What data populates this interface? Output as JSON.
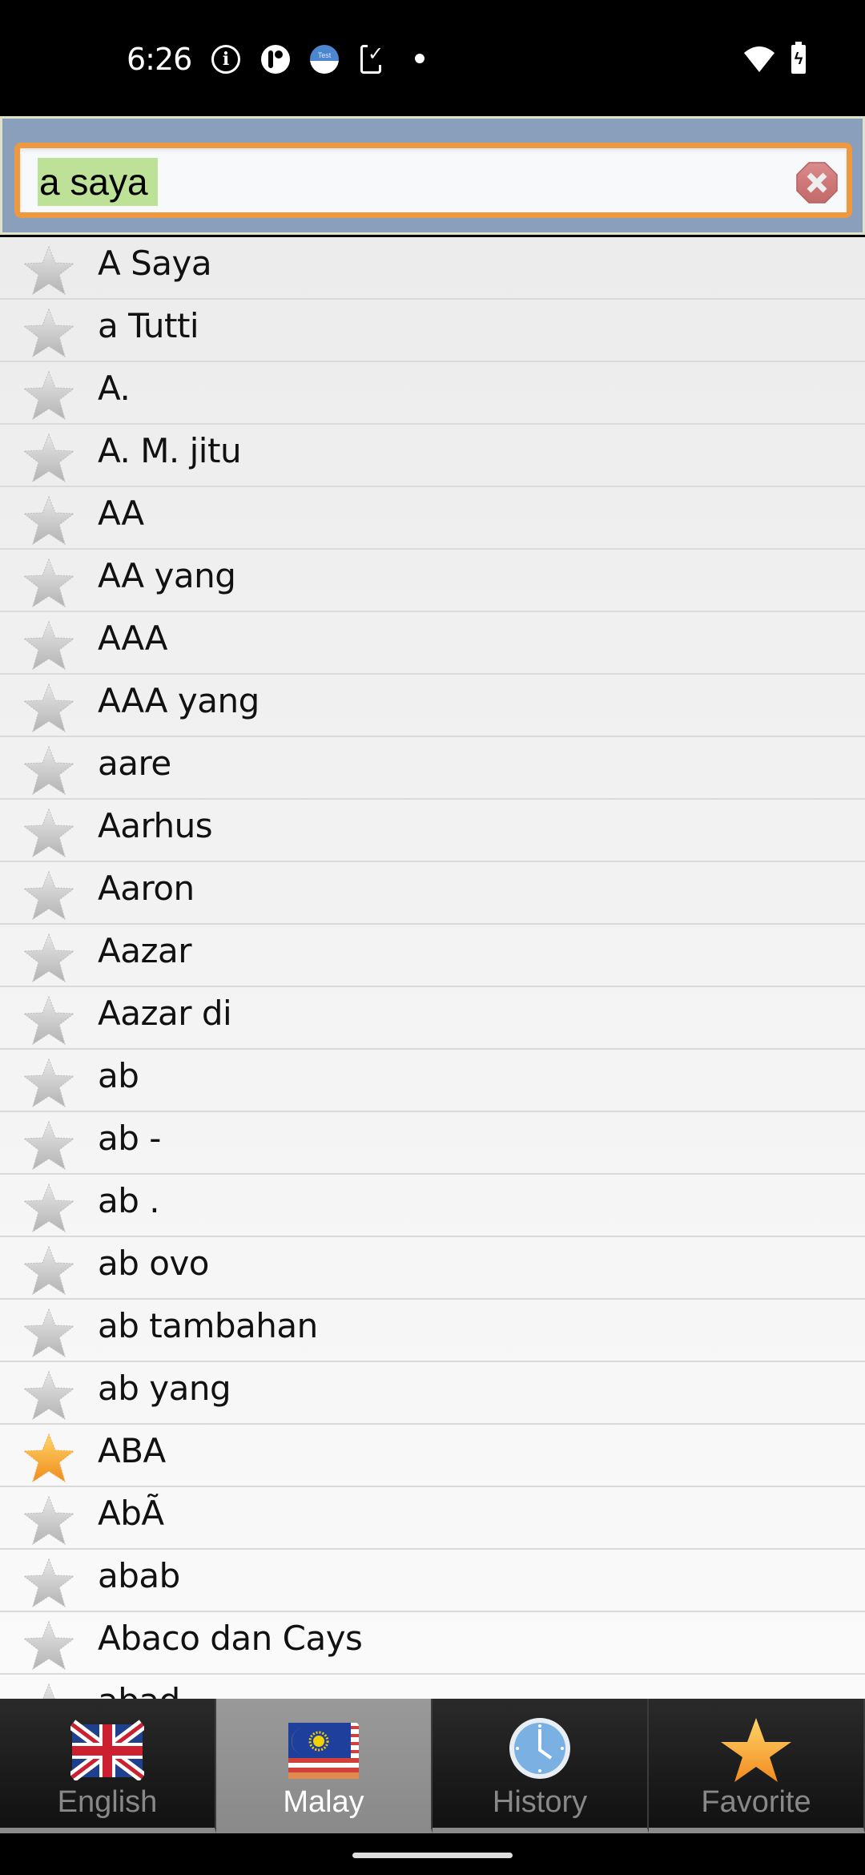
{
  "status_bar": {
    "time": "6:26",
    "icons": [
      "info-icon",
      "p-app-icon",
      "test-app-icon",
      "phone-check-icon",
      "dot-icon",
      "wifi-icon",
      "battery-charging-icon"
    ],
    "test_icon_label": "Test"
  },
  "search": {
    "value": "a saya",
    "clear_icon": "clear-icon",
    "colors": {
      "panel": "#8a9fbb",
      "border": "#ee9840",
      "highlight": "#bde197"
    }
  },
  "word_list": {
    "items": [
      {
        "word": "A Saya",
        "favorite": false
      },
      {
        "word": "a Tutti",
        "favorite": false
      },
      {
        "word": "A.",
        "favorite": false
      },
      {
        "word": "A. M. jitu",
        "favorite": false
      },
      {
        "word": "AA",
        "favorite": false
      },
      {
        "word": "AA yang",
        "favorite": false
      },
      {
        "word": "AAA",
        "favorite": false
      },
      {
        "word": "AAA yang",
        "favorite": false
      },
      {
        "word": "aare",
        "favorite": false
      },
      {
        "word": "Aarhus",
        "favorite": false
      },
      {
        "word": "Aaron",
        "favorite": false
      },
      {
        "word": "Aazar",
        "favorite": false
      },
      {
        "word": "Aazar di",
        "favorite": false
      },
      {
        "word": "ab",
        "favorite": false
      },
      {
        "word": "ab -",
        "favorite": false
      },
      {
        "word": "ab .",
        "favorite": false
      },
      {
        "word": "ab ovo",
        "favorite": false
      },
      {
        "word": "ab tambahan",
        "favorite": false
      },
      {
        "word": "ab yang",
        "favorite": false
      },
      {
        "word": "ABA",
        "favorite": true
      },
      {
        "word": "AbÃ",
        "favorite": false
      },
      {
        "word": "abab",
        "favorite": false
      },
      {
        "word": "Abaco dan Cays",
        "favorite": false
      },
      {
        "word": "abad",
        "favorite": false
      }
    ]
  },
  "tabs": [
    {
      "label": "English",
      "icon": "uk-flag-icon",
      "active": false
    },
    {
      "label": "Malay",
      "icon": "malaysia-flag-icon",
      "active": true
    },
    {
      "label": "History",
      "icon": "clock-icon",
      "active": false
    },
    {
      "label": "Favorite",
      "icon": "star-icon",
      "active": false
    }
  ]
}
